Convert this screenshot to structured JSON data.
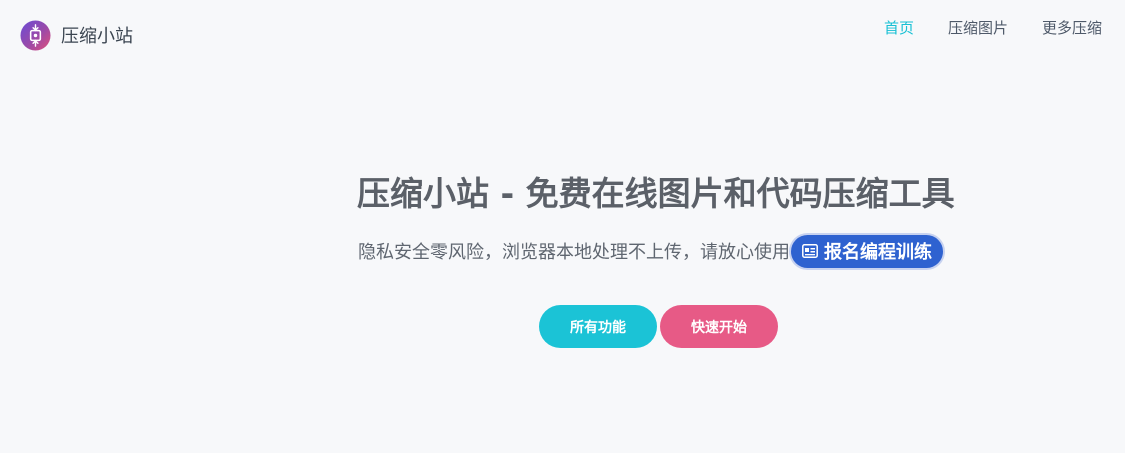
{
  "brand": {
    "name": "压缩小站",
    "logo_icon": "compress-logo-icon"
  },
  "nav": {
    "items": [
      {
        "label": "首页",
        "active": true
      },
      {
        "label": "压缩图片",
        "active": false
      },
      {
        "label": "更多压缩",
        "active": false
      }
    ]
  },
  "hero": {
    "title": "压缩小站 - 免费在线图片和代码压缩工具",
    "subtitle": "隐私安全零风险，浏览器本地处理不上传，请放心使用",
    "promo": {
      "label": "报名编程训练",
      "icon": "id-card-icon"
    }
  },
  "actions": {
    "all_features": "所有功能",
    "quick_start": "快速开始"
  },
  "colors": {
    "accent": "#17c0d4",
    "cta_primary": "#1bc3d6",
    "cta_secondary": "#e75a86",
    "promo": "#2e62d0",
    "background": "#f7f8fa"
  }
}
